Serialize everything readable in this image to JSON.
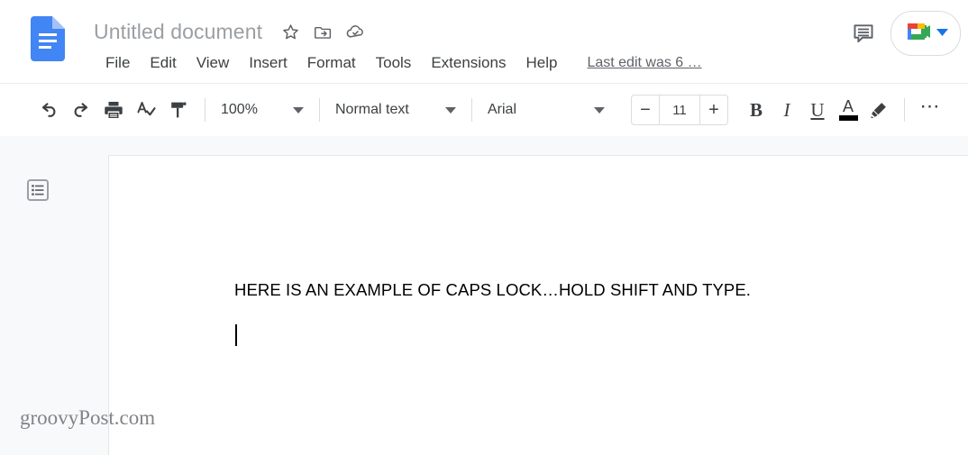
{
  "app": {
    "name": "Google Docs",
    "logo_icon": "docs-file-icon",
    "logo_color": "#4285f4"
  },
  "header": {
    "document_title": "Untitled document",
    "title_actions": [
      {
        "name": "star-icon",
        "label": "Star"
      },
      {
        "name": "move-to-folder-icon",
        "label": "Move"
      },
      {
        "name": "cloud-saved-icon",
        "label": "See document status"
      }
    ],
    "menu_items": [
      "File",
      "Edit",
      "View",
      "Insert",
      "Format",
      "Tools",
      "Extensions",
      "Help"
    ],
    "last_edit": "Last edit was 6 …",
    "comment_icon": "comment-history-icon",
    "meet_icon": "google-meet-icon",
    "meet_caret_color": "#1a73e8"
  },
  "toolbar": {
    "undo_icon": "undo-icon",
    "redo_icon": "redo-icon",
    "print_icon": "print-icon",
    "spellcheck_icon": "spellcheck-icon",
    "paint_format_icon": "paint-format-icon",
    "zoom_value": "100%",
    "paragraph_style": "Normal text",
    "font_family": "Arial",
    "font_size": "11",
    "font_size_decrease": "−",
    "font_size_increase": "+",
    "bold_label": "B",
    "italic_label": "I",
    "underline_label": "U",
    "text_color_label": "A",
    "text_color_value": "#000000",
    "highlight_icon": "highlight-pen-icon",
    "more_label": "⋯"
  },
  "document": {
    "outline_icon": "document-outline-icon",
    "body_text": "HERE IS AN EXAMPLE OF CAPS LOCK…HOLD SHIFT AND TYPE.",
    "cursor_visible": true
  },
  "watermark": {
    "text": "groovyPost.com"
  }
}
